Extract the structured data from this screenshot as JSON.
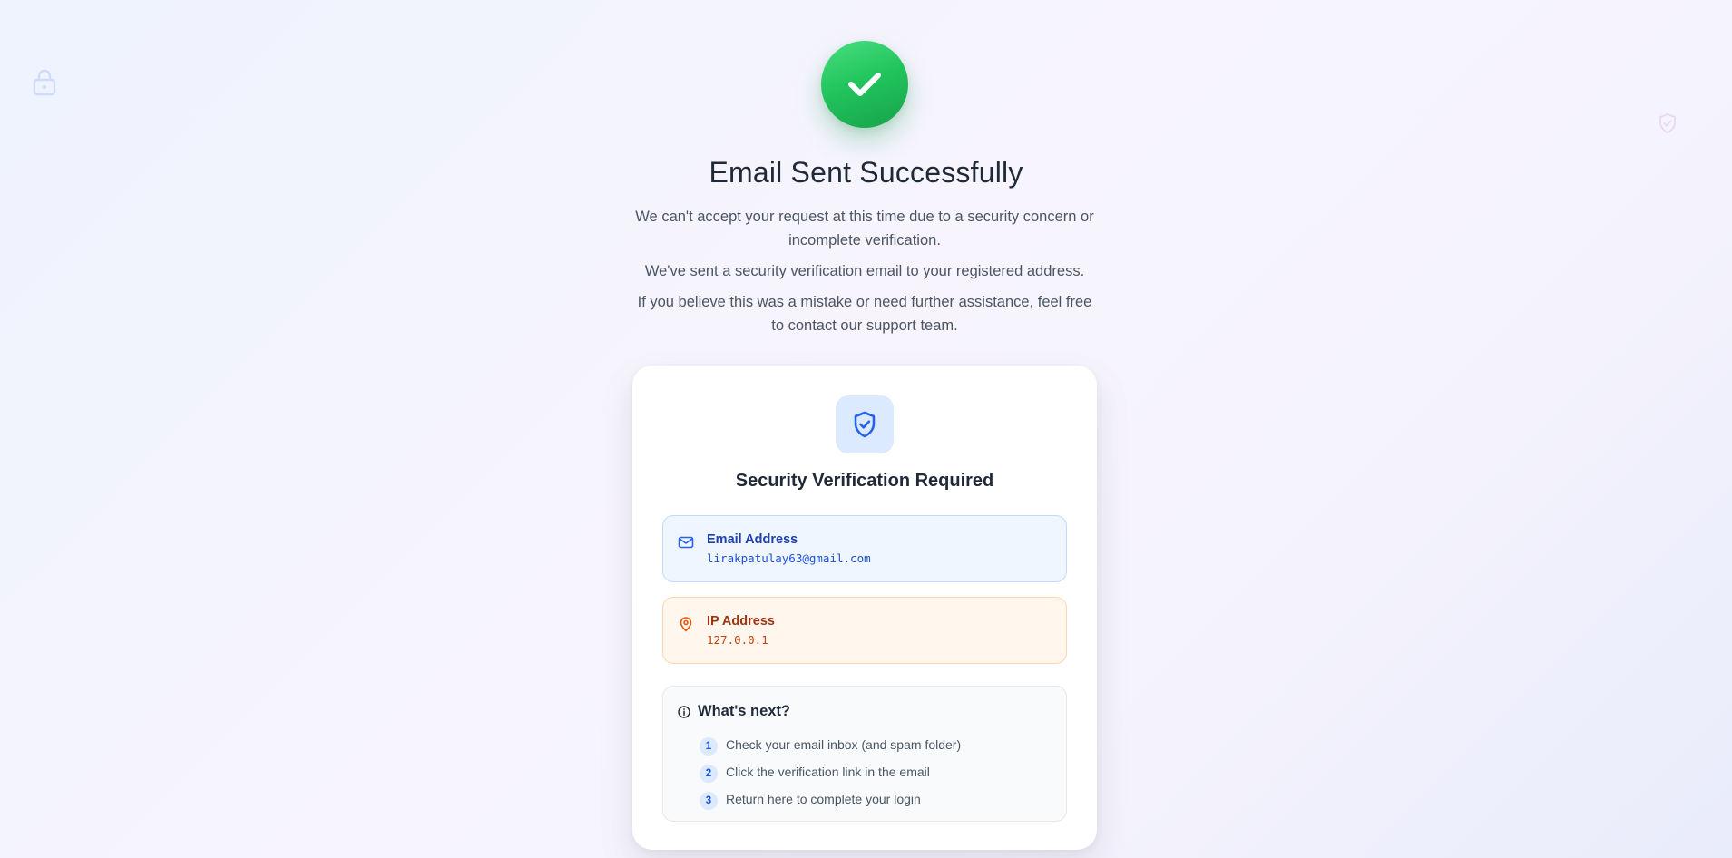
{
  "header": {
    "title": "Email Sent Successfully",
    "message_1": "We can't accept your request at this time due to a security concern or incomplete verification.",
    "message_2": "We've sent a security verification email to your registered address.",
    "message_3": "If you believe this was a mistake or need further assistance, feel free to contact our support team."
  },
  "card": {
    "title": "Security Verification Required",
    "email": {
      "label": "Email Address",
      "value": "lirakpatulay63@gmail.com"
    },
    "ip": {
      "label": "IP Address",
      "value": "127.0.0.1"
    },
    "next": {
      "title": "What's next?",
      "steps": [
        {
          "num": "1",
          "text": "Check your email inbox (and spam folder)"
        },
        {
          "num": "2",
          "text": "Click the verification link in the email"
        },
        {
          "num": "3",
          "text": "Return here to complete your login"
        }
      ]
    }
  },
  "colors": {
    "success": "#22c55e",
    "accent": "#2563eb",
    "email_bg": "#eff6ff",
    "ip_bg": "#fff7ed"
  },
  "icons": [
    "lock-icon",
    "shield-check-icon",
    "check-icon",
    "mail-icon",
    "map-pin-icon",
    "info-icon"
  ]
}
